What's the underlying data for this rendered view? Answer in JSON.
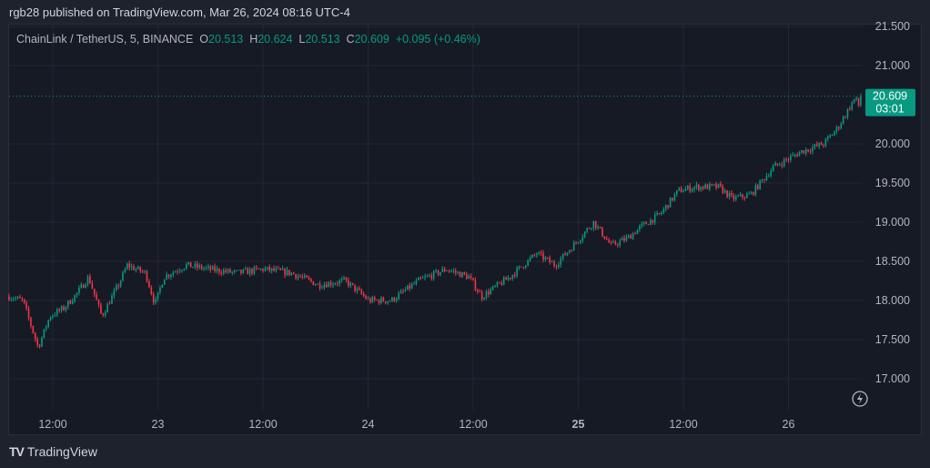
{
  "header": {
    "published": "rgb28 published on TradingView.com, Mar 26, 2024 08:16 UTC-4"
  },
  "legend": {
    "symbol": "ChainLink / TetherUS, 5, BINANCE",
    "o_label": "O",
    "o": "20.513",
    "h_label": "H",
    "h": "20.624",
    "l_label": "L",
    "l": "20.513",
    "c_label": "C",
    "c": "20.609",
    "change": "+0.095 (+0.46%)"
  },
  "last_price": {
    "value": "20.609",
    "countdown": "03:01"
  },
  "footer": {
    "logo_text": "TradingView",
    "logo_mark": "TV"
  },
  "colors": {
    "up": "#089981",
    "down": "#f23645",
    "background": "#161a25"
  },
  "chart_data": {
    "type": "candlestick",
    "title": "ChainLink / TetherUS, 5, BINANCE",
    "y_ticks": [
      "21.500",
      "21.000",
      "20.000",
      "19.500",
      "19.000",
      "18.500",
      "18.000",
      "17.500",
      "17.000"
    ],
    "ylim": [
      16.7,
      21.55
    ],
    "x_ticks": [
      {
        "label": "12:00",
        "time": "2024-03-22 12:00",
        "bold": false
      },
      {
        "label": "23",
        "time": "2024-03-23 00:00",
        "bold": false
      },
      {
        "label": "12:00",
        "time": "2024-03-23 12:00",
        "bold": false
      },
      {
        "label": "24",
        "time": "2024-03-24 00:00",
        "bold": false
      },
      {
        "label": "12:00",
        "time": "2024-03-24 12:00",
        "bold": false
      },
      {
        "label": "25",
        "time": "2024-03-25 00:00",
        "bold": true
      },
      {
        "label": "12:00",
        "time": "2024-03-25 12:00",
        "bold": false
      },
      {
        "label": "26",
        "time": "2024-03-26 00:00",
        "bold": false
      }
    ],
    "price_path": [
      [
        "2024-03-22 07:00",
        18.05
      ],
      [
        "2024-03-22 08:35",
        18.0
      ],
      [
        "2024-03-22 10:20",
        17.4
      ],
      [
        "2024-03-22 11:40",
        17.8
      ],
      [
        "2024-03-22 13:15",
        17.9
      ],
      [
        "2024-03-22 14:50",
        18.1
      ],
      [
        "2024-03-22 16:05",
        18.3
      ],
      [
        "2024-03-22 17:35",
        17.8
      ],
      [
        "2024-03-22 19:30",
        18.2
      ],
      [
        "2024-03-22 20:30",
        18.45
      ],
      [
        "2024-03-22 22:35",
        18.35
      ],
      [
        "2024-03-22 23:40",
        17.95
      ],
      [
        "2024-03-23 00:40",
        18.3
      ],
      [
        "2024-03-23 03:15",
        18.45
      ],
      [
        "2024-03-23 05:50",
        18.4
      ],
      [
        "2024-03-23 09:00",
        18.35
      ],
      [
        "2024-03-23 12:05",
        18.4
      ],
      [
        "2024-03-23 15:15",
        18.35
      ],
      [
        "2024-03-23 18:20",
        18.2
      ],
      [
        "2024-03-23 21:25",
        18.25
      ],
      [
        "2024-03-24 00:05",
        18.0
      ],
      [
        "2024-03-24 02:40",
        18.0
      ],
      [
        "2024-03-24 05:45",
        18.25
      ],
      [
        "2024-03-24 08:55",
        18.4
      ],
      [
        "2024-03-24 11:30",
        18.3
      ],
      [
        "2024-03-24 13:00",
        18.05
      ],
      [
        "2024-03-24 16:10",
        18.3
      ],
      [
        "2024-03-24 19:15",
        18.6
      ],
      [
        "2024-03-24 21:20",
        18.45
      ],
      [
        "2024-03-24 23:25",
        18.7
      ],
      [
        "2024-03-25 01:45",
        19.0
      ],
      [
        "2024-03-25 03:45",
        18.7
      ],
      [
        "2024-03-25 05:40",
        18.8
      ],
      [
        "2024-03-25 07:15",
        18.95
      ],
      [
        "2024-03-25 09:20",
        19.1
      ],
      [
        "2024-03-25 11:25",
        19.4
      ],
      [
        "2024-03-25 13:25",
        19.45
      ],
      [
        "2024-03-25 16:05",
        19.45
      ],
      [
        "2024-03-25 17:35",
        19.3
      ],
      [
        "2024-03-25 19:40",
        19.35
      ],
      [
        "2024-03-25 22:15",
        19.7
      ],
      [
        "2024-03-26 01:25",
        19.9
      ],
      [
        "2024-03-26 04:00",
        20.0
      ],
      [
        "2024-03-26 05:35",
        20.2
      ],
      [
        "2024-03-26 07:40",
        20.6
      ],
      [
        "2024-03-26 07:55",
        20.45
      ],
      [
        "2024-03-26 08:15",
        20.609
      ]
    ],
    "last_price": 20.609,
    "grid": true
  }
}
